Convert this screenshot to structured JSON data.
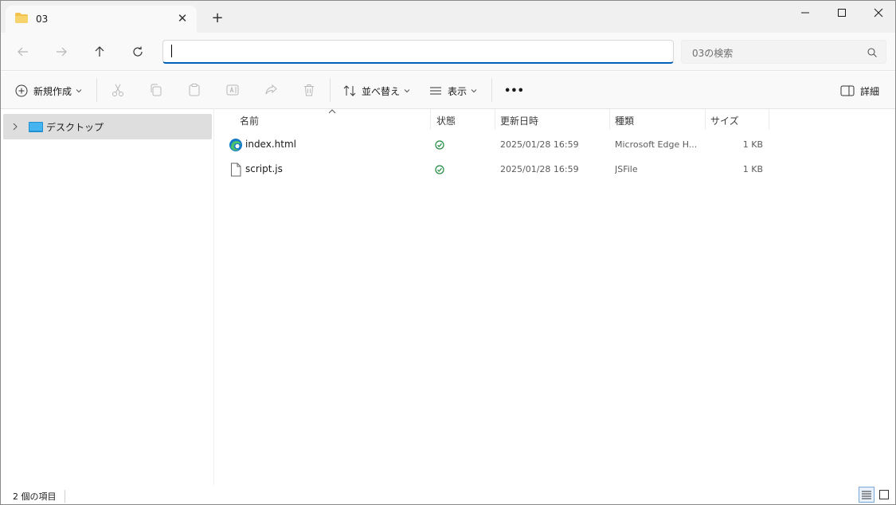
{
  "tab": {
    "title": "03",
    "close_glyph": "✕",
    "new_tab_glyph": "+"
  },
  "address": {
    "value": ""
  },
  "search": {
    "placeholder": "03の検索"
  },
  "commands": {
    "new": "新規作成",
    "sort": "並べ替え",
    "view": "表示",
    "more": "•••",
    "details": "詳細"
  },
  "nav": {
    "items": [
      {
        "label": "デスクトップ"
      }
    ]
  },
  "columns": {
    "name": "名前",
    "status": "状態",
    "modified": "更新日時",
    "type": "種類",
    "size": "サイズ"
  },
  "files": [
    {
      "name": "index.html",
      "modified": "2025/01/28 16:59",
      "type": "Microsoft Edge H...",
      "size": "1 KB",
      "icon": "edge-icon"
    },
    {
      "name": "script.js",
      "modified": "2025/01/28 16:59",
      "type": "JSFile",
      "size": "1 KB",
      "icon": "document-icon"
    }
  ],
  "status": {
    "count": "2 個の項目"
  },
  "colors": {
    "accent": "#005fb8",
    "synced": "#1f8a3d",
    "folder": "#f2c14e"
  }
}
